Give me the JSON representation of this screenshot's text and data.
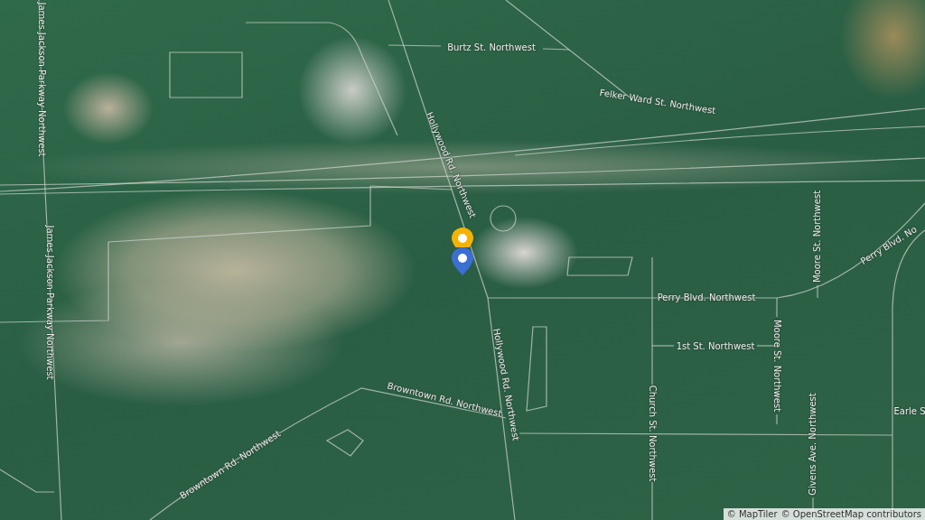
{
  "map": {
    "labels": [
      {
        "text": "Burtz St. Northwest"
      },
      {
        "text": "Felker Ward St. Northwest"
      },
      {
        "text": "Hollywood Rd. Northwest"
      },
      {
        "text": "James Jackson Parkway Northwest"
      },
      {
        "text": "James Jackson Parkway Northwest"
      },
      {
        "text": "Moore St. Northwest"
      },
      {
        "text": "Perry Blvd. No"
      },
      {
        "text": "Perry Blvd. Northwest"
      },
      {
        "text": "1st St. Northwest"
      },
      {
        "text": "Hollywood Rd. Northwest"
      },
      {
        "text": "Moore St. Northwest"
      },
      {
        "text": "Church St. Northwest"
      },
      {
        "text": "Givens Ave. Northwest"
      },
      {
        "text": "Earle S"
      },
      {
        "text": "Browntown Rd. Northwest"
      },
      {
        "text": "Browntown Rd. Northwest"
      }
    ],
    "markers": [
      {
        "color": "#f5b301"
      },
      {
        "color": "#3b6fd4"
      }
    ],
    "attribution": [
      "© MapTiler",
      "© OpenStreetMap contributors"
    ]
  }
}
